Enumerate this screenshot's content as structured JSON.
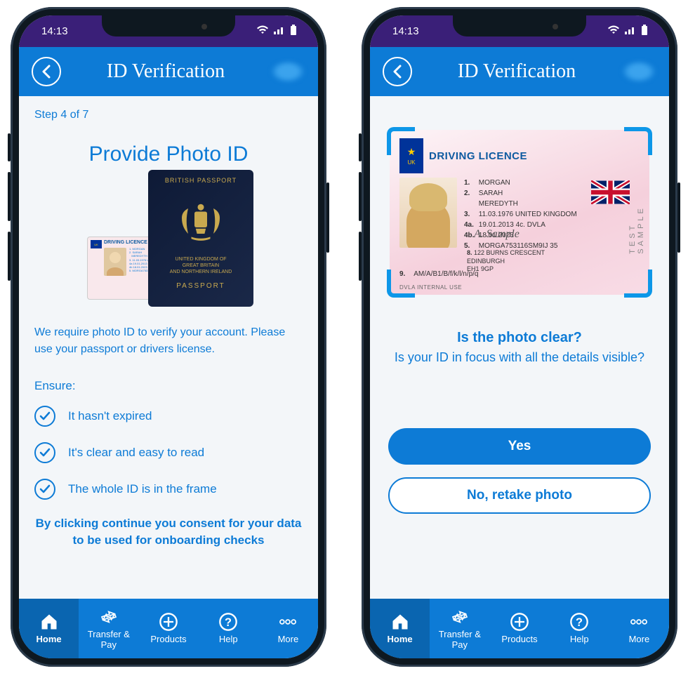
{
  "status": {
    "time": "14:13"
  },
  "header": {
    "title": "ID Verification"
  },
  "screen1": {
    "step": "Step 4 of 7",
    "heading": "Provide Photo ID",
    "passport": {
      "top": "BRITISH PASSPORT",
      "country": "UNITED KINGDOM OF\nGREAT BRITAIN\nAND NORTHERN IRELAND",
      "label": "PASSPORT"
    },
    "licence_small_title": "DRIVING LICENCE",
    "info": "We require photo ID to verify your account. Please use your passport or drivers license.",
    "ensure_label": "Ensure:",
    "checks": [
      "It hasn't expired",
      "It's clear and easy to read",
      "The whole ID is in the frame"
    ],
    "consent": "By clicking continue you consent for your data to be used for onboarding checks"
  },
  "screen2": {
    "licence": {
      "title": "DRIVING LICENCE",
      "eu_code": "UK",
      "rows": {
        "r1": "MORGAN",
        "r2": "SARAH",
        "r2b": "MEREDYTH",
        "r3": "11.03.1976 UNITED KINGDOM",
        "r4a": "19.01.2013",
        "r4b": "DVLA",
        "r4c": "18.01.2023",
        "r5": "MORGA753116SM9IJ 35",
        "sig": "A. Sample",
        "addr8": "122 BURNS CRESCENT\nEDINBURGH\nEH1 9GP",
        "r9": "AM/A/B1/B/f/k/l/n/p/q",
        "bottom": "DVLA INTERNAL USE",
        "side": "TEST SAMPLE"
      }
    },
    "q1": "Is the photo clear?",
    "q2": "Is your ID in focus with all the details visible?",
    "yes": "Yes",
    "no": "No, retake photo"
  },
  "nav": {
    "home": "Home",
    "transfer": "Transfer & Pay",
    "products": "Products",
    "help": "Help",
    "more": "More"
  }
}
